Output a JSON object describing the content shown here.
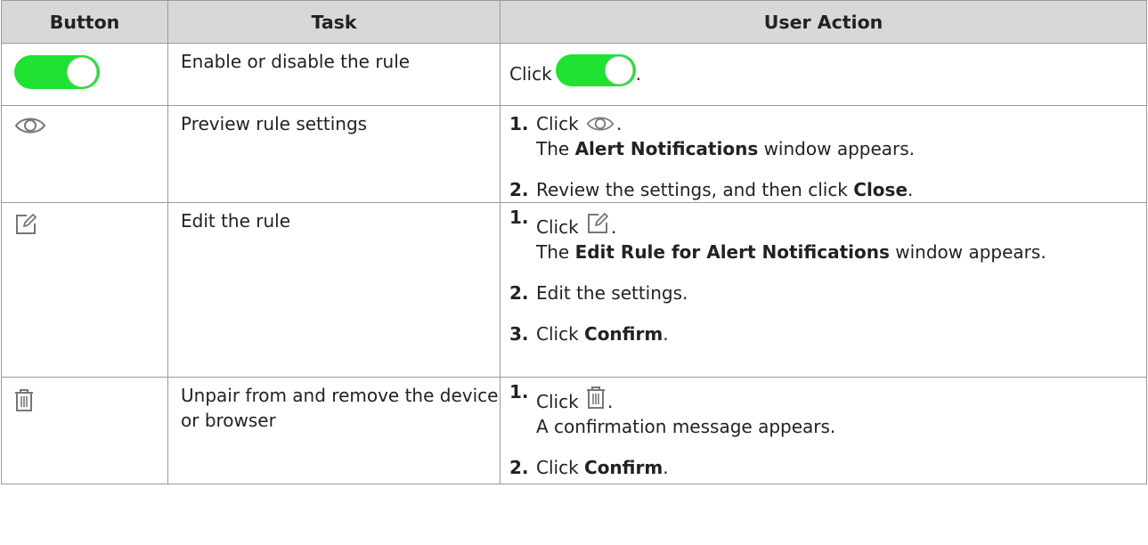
{
  "headers": {
    "button": "Button",
    "task": "Task",
    "user_action": "User Action"
  },
  "rows": [
    {
      "icon": "toggle-switch-icon",
      "task": "Enable or disable the rule",
      "action": {
        "prefix": "Click",
        "suffix": "."
      }
    },
    {
      "icon": "eye-icon",
      "task": "Preview rule settings",
      "steps": [
        {
          "num": "1.",
          "click": "Click",
          "period": ".",
          "line2_a": "The",
          "line2_bold": "Alert Notifications",
          "line2_b": "window appears."
        },
        {
          "num": "2.",
          "text": "Review the settings, and then click",
          "bold": "Close",
          "end": "."
        }
      ]
    },
    {
      "icon": "edit-icon",
      "task": "Edit the rule",
      "steps": [
        {
          "num": "1.",
          "click": "Click",
          "period": ".",
          "line2_a": "The",
          "line2_bold": "Edit Rule for Alert Notifications",
          "line2_b": "window appears."
        },
        {
          "num": "2.",
          "text": "Edit the settings."
        },
        {
          "num": "3.",
          "text": "Click",
          "bold": "Confirm",
          "end": "."
        }
      ]
    },
    {
      "icon": "trash-icon",
      "task": "Unpair from and remove the device or browser",
      "steps": [
        {
          "num": "1.",
          "click": "Click",
          "period": ".",
          "line2": "A confirmation message appears."
        },
        {
          "num": "2.",
          "text": "Click",
          "bold": "Confirm",
          "end": "."
        }
      ]
    }
  ],
  "colors": {
    "toggle_green": "#1fe233",
    "header_bg": "#d8d8d8",
    "border": "#9a9a9a",
    "icon_gray": "#777777"
  }
}
